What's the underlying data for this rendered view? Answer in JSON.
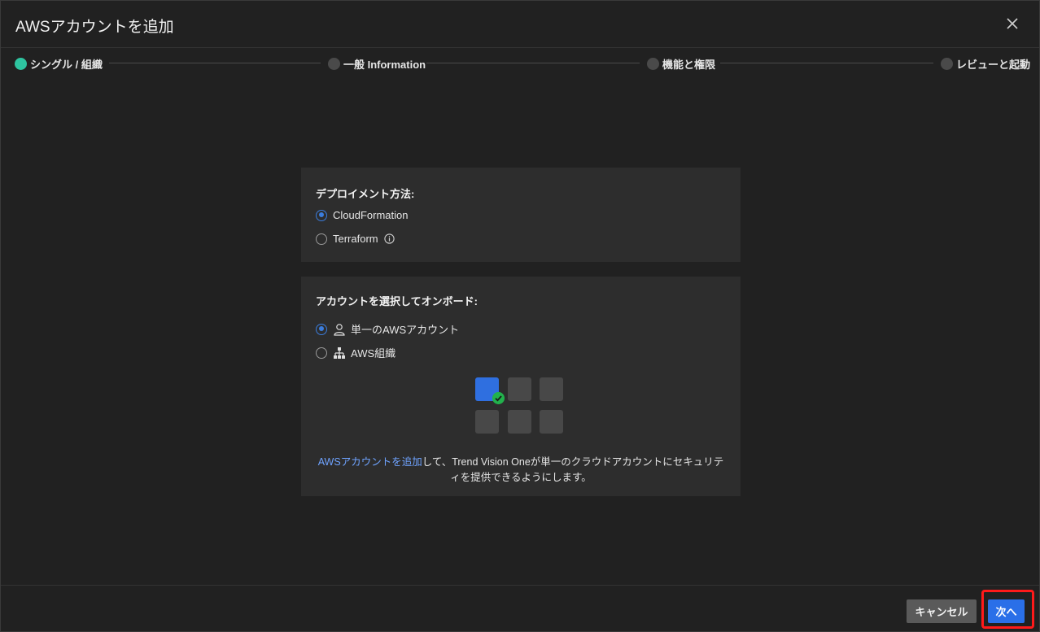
{
  "dialog": {
    "title": "AWSアカウントを追加",
    "close_icon": "close-icon"
  },
  "steps": [
    {
      "label": "シングル / 組織",
      "active": true
    },
    {
      "label": "一般 Information",
      "active": false
    },
    {
      "label": "機能と権限",
      "active": false
    },
    {
      "label": "レビューと起動",
      "active": false
    }
  ],
  "deployment": {
    "heading": "デプロイメント方法:",
    "options": [
      {
        "label": "CloudFormation",
        "selected": true
      },
      {
        "label": "Terraform",
        "selected": false,
        "icon": "info-icon"
      }
    ]
  },
  "account": {
    "heading": "アカウントを選択してオンボード:",
    "options": [
      {
        "label": "単一のAWSアカウント",
        "selected": true,
        "icon": "user-icon"
      },
      {
        "label": "AWS組織",
        "selected": false,
        "icon": "org-tree-icon"
      }
    ],
    "description_link": "AWSアカウントを追加",
    "description_text_1": "して、Trend Vision Oneが単一のクラウドアカウントにセキュリテ",
    "description_text_2": "ィを提供できるようにします。"
  },
  "footer": {
    "cancel_label": "キャンセル",
    "next_label": "次へ"
  },
  "colors": {
    "accent": "#2a6fe8",
    "step_active": "#2ec4a0",
    "highlight": "#ff1a1a"
  }
}
